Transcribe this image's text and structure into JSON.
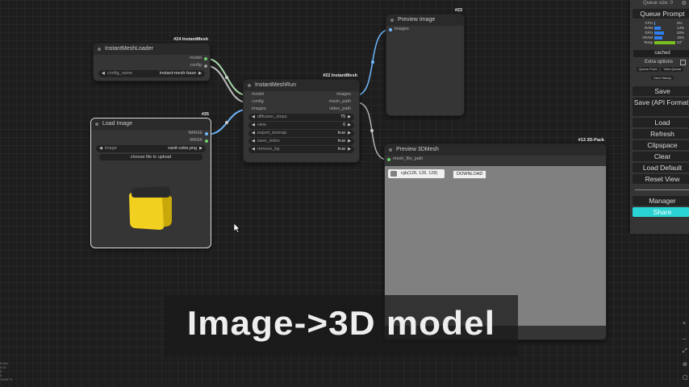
{
  "canvas": {
    "wire_colors": {
      "model": "#a8d8a8",
      "config": "#bdbdbd",
      "images": "#6fb8ff",
      "mesh": "#b3b3b3"
    }
  },
  "nodes": {
    "loader": {
      "badge": "#24 InstantMesh",
      "title": "InstantMeshLoader",
      "outputs": [
        "model",
        "config"
      ],
      "widgets": [
        {
          "label": "config_name",
          "value": "instant-mesh-base"
        }
      ]
    },
    "load_image": {
      "badge": "#25",
      "title": "Load Image",
      "outputs": [
        "IMAGE",
        "MASK"
      ],
      "widgets": [
        {
          "label": "image",
          "value": "vanit-cebe.png"
        }
      ],
      "upload_label": "choose file to upload",
      "preview_colors": {
        "top": "#2a2a2a",
        "front": "#f2d020",
        "side": "#c8a80a"
      }
    },
    "run": {
      "badge": "#22 InstantMesh",
      "title": "InstantMeshRun",
      "inputs": [
        "model",
        "config",
        "images"
      ],
      "outputs": [
        "images",
        "mesh_path",
        "video_path"
      ],
      "widgets": [
        {
          "label": "diffusion_steps",
          "value": "75"
        },
        {
          "label": "view",
          "value": "6"
        },
        {
          "label": "export_texmap",
          "value": "true"
        },
        {
          "label": "save_video",
          "value": "true"
        },
        {
          "label": "remove_bg",
          "value": "true"
        }
      ]
    },
    "preview_image": {
      "badge": "#23",
      "title": "Preview Image",
      "inputs": [
        "images"
      ]
    },
    "preview_3d": {
      "badge": "#13 3D-Pack",
      "title": "Preview 3DMesh",
      "inputs": [
        "mesh_file_path"
      ],
      "color_label": "rgb(128, 128, 128)",
      "download_label": "DOWNLOAD",
      "viewer_color": "#808080"
    }
  },
  "menu": {
    "queue_size": "Queue size: 0",
    "queue_prompt": "Queue Prompt",
    "stats": [
      {
        "label": "CPU",
        "value": "0%",
        "fraction": 0.0,
        "color": "#4aa0ff"
      },
      {
        "label": "RAM",
        "value": "14%",
        "fraction": 0.14,
        "color": "#2f7ff0"
      },
      {
        "label": "GPU",
        "value": "20%",
        "fraction": 0.2,
        "color": "#2f7ff0"
      },
      {
        "label": "VRAM",
        "value": "16%",
        "fraction": 0.16,
        "color": "#2f7ff0"
      },
      {
        "label": "Temp",
        "value": "43°",
        "fraction": 0.43,
        "color": "#7cc020"
      }
    ],
    "cached": "cached",
    "extra_options": "Extra options",
    "queue_front": "Queue Front",
    "view_queue": "View Queue",
    "view_history": "View History",
    "buttons": [
      "Save",
      "Save (API Format)",
      "Load",
      "Refresh",
      "Clipspace",
      "Clear",
      "Load Default",
      "Reset View"
    ],
    "manager": "Manager",
    "share": "Share"
  },
  "caption": "Image->3D model",
  "corner_stats": [
    "0.00s",
    "0.00",
    "0",
    "0",
    "75.60 T1"
  ]
}
